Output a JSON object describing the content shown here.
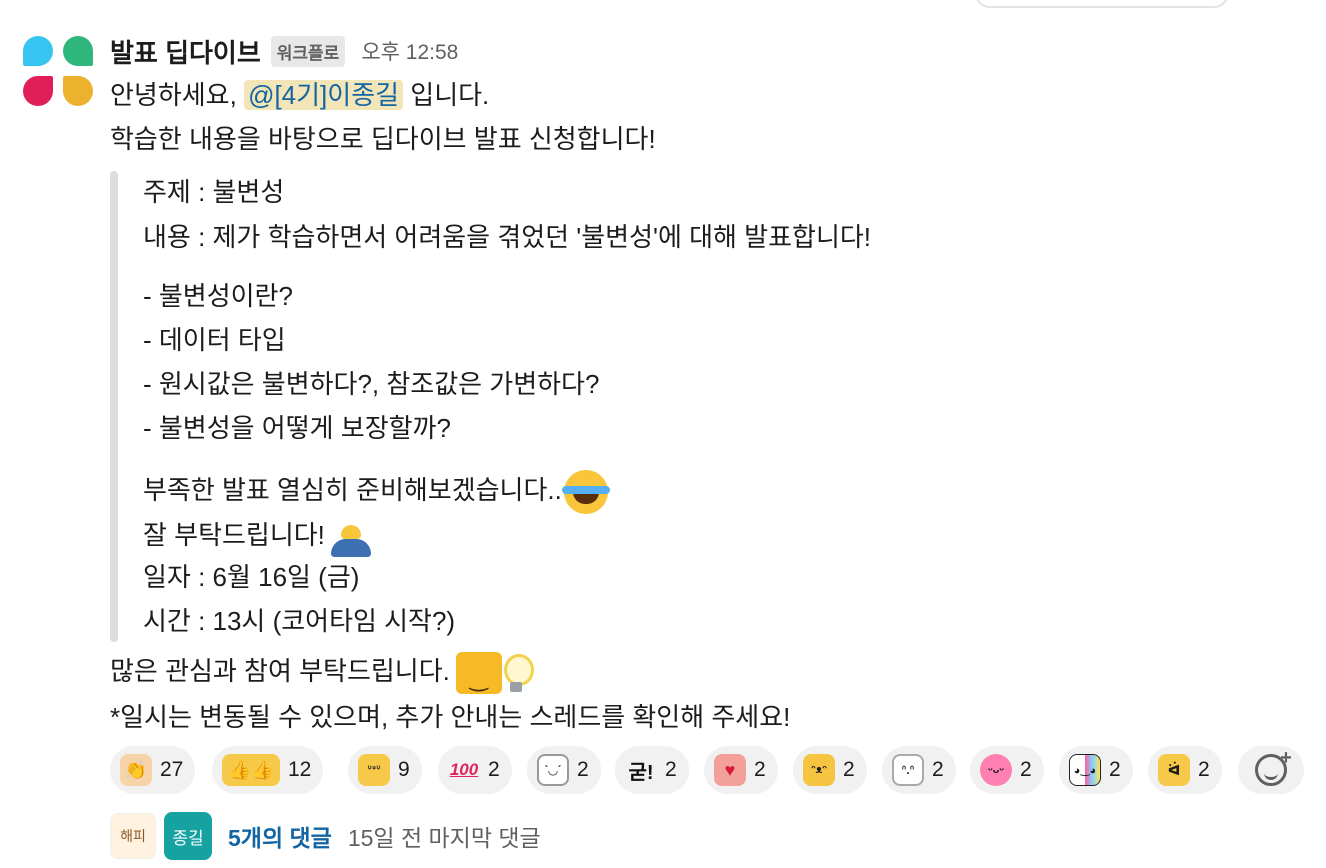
{
  "message": {
    "sender": "발표 딥다이브",
    "badge": "워크플로",
    "time": "오후 12:58",
    "greeting_pre": "안녕하세요, ",
    "mention": "@[4기]이종길",
    "greeting_post": " 입니다.",
    "intro": "학습한 내용을 바탕으로 딥다이브 발표 신청합니다!",
    "quote": {
      "topic": "주제 : 불변성",
      "content": "내용 : 제가 학습하면서 어려움을 겪었던 '불변성'에 대해 발표합니다!",
      "bullets": [
        "- 불변성이란?",
        "- 데이터 타입",
        "- 원시값은 불변하다?, 참조값은 가변하다?",
        "- 불변성을 어떻게 보장할까?"
      ],
      "prepare": "부족한 발표 열심히 준비해보겠습니다..",
      "thanks": "잘 부탁드립니다!",
      "date": "일자 : 6월 16일 (금)",
      "time": "시간 : 13시 (코어타임 시작?)"
    },
    "closing": "많은 관심과 참여 부탁드립니다.",
    "note": "*일시는 변동될 수 있으며, 추가 안내는 스레드를 확인해 주세요!"
  },
  "reactions": [
    {
      "icon": "clap-icon",
      "glyph": "👏",
      "count": "27",
      "color": "#f6d3a8"
    },
    {
      "icon": "thumbsup-icon",
      "glyph": "👍👍",
      "count": "12",
      "color": "#f7c948"
    },
    {
      "icon": "cat-angry-icon",
      "glyph": "ᐡᐤᐡ",
      "count": "9",
      "color": "#f7c948"
    },
    {
      "icon": "hundred-icon",
      "glyph": "100",
      "count": "2",
      "color": "#ffd6e4"
    },
    {
      "icon": "ghost-duck-icon",
      "glyph": "ˋ◡ˊ",
      "count": "2",
      "color": "#f3f3f3"
    },
    {
      "icon": "korean-text-icon",
      "glyph": "굳!",
      "count": "2",
      "color": "#f1f1f1"
    },
    {
      "icon": "heart-hug-icon",
      "glyph": "♥",
      "count": "2",
      "color": "#f3a09b"
    },
    {
      "icon": "tiger-icon",
      "glyph": "ᵔᴥᵔ",
      "count": "2",
      "color": "#f5c542"
    },
    {
      "icon": "pray-icon",
      "glyph": "ᐢ.ᐢ",
      "count": "2",
      "color": "#f3f3f3"
    },
    {
      "icon": "pink-blob-icon",
      "glyph": "ᵕᴗᵕ",
      "count": "2",
      "color": "#ff7fb3"
    },
    {
      "icon": "panda-rainbow-icon",
      "glyph": "◕‿◕",
      "count": "2",
      "color": "#e9e9ff"
    },
    {
      "icon": "yellow-cat-icon",
      "glyph": "ᐛ",
      "count": "2",
      "color": "#f7c948"
    }
  ],
  "thread": {
    "avatar1_text": "해피",
    "avatar2_text": "종길",
    "replies": "5개의 댓글",
    "last": "15일 전 마지막 댓글"
  }
}
